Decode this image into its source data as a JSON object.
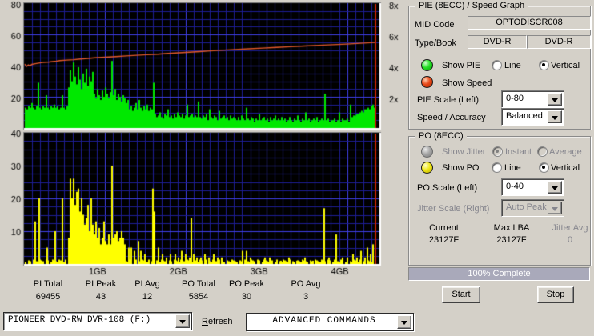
{
  "chart": {
    "grid": {
      "bg": "#000000",
      "minor": "#1e1e96",
      "major": "#4040e8"
    },
    "marker_color": "#cc2200",
    "x_labels": [
      "1GB",
      "2GB",
      "3GB",
      "4GB"
    ],
    "pie_plot": {
      "y_ticks": [
        "80",
        "60",
        "40",
        "20"
      ],
      "speed_ticks": [
        "8x",
        "6x",
        "4x",
        "2x"
      ],
      "bar_color": "#00e800",
      "speed_color": "#e55a2b",
      "bar_values": [
        13,
        12,
        14,
        13,
        16,
        13,
        12,
        14,
        29,
        13,
        12,
        14,
        13,
        21,
        13,
        12,
        14,
        13,
        15,
        13,
        14,
        12,
        13,
        21,
        13,
        12,
        14,
        26,
        37,
        30,
        42,
        33,
        28,
        39,
        31,
        25,
        35,
        29,
        38,
        27,
        33,
        30,
        36,
        22,
        19,
        25,
        21,
        18,
        24,
        20,
        26,
        22,
        19,
        23,
        43,
        21,
        25,
        18,
        22,
        20,
        17,
        21,
        19,
        16,
        18,
        12,
        14,
        11,
        13,
        16,
        12,
        18,
        13,
        11,
        14,
        12,
        15,
        11,
        13,
        12,
        29,
        9,
        7,
        8,
        10,
        7,
        6,
        9,
        8,
        12,
        7,
        8,
        6,
        9,
        7,
        10,
        8,
        7,
        9,
        6,
        8,
        15,
        7,
        8,
        9,
        7,
        8,
        7,
        17,
        7,
        6,
        8,
        7,
        9,
        5,
        12,
        7,
        6,
        8,
        7,
        5,
        11,
        6,
        7,
        8,
        6,
        7,
        5,
        8,
        6,
        7,
        6,
        5,
        7,
        5,
        8,
        6,
        5,
        13,
        6,
        5,
        7,
        6,
        4,
        6,
        5,
        9,
        5,
        6,
        7,
        5,
        6,
        4,
        7,
        5,
        6,
        8,
        5,
        6,
        5,
        7,
        5,
        6,
        4,
        5,
        7,
        5,
        4,
        6,
        5,
        8,
        5,
        4,
        6,
        5,
        10,
        5,
        6,
        4,
        5,
        6,
        5,
        7,
        4,
        5,
        6,
        5,
        22,
        5,
        6,
        4,
        5,
        5,
        6,
        4,
        5,
        10,
        4,
        6,
        5,
        5,
        6,
        4,
        15,
        7,
        8,
        8,
        9,
        9,
        10,
        11,
        10,
        12,
        12,
        13,
        12,
        14,
        15,
        13
      ],
      "speed_line": [
        [
          0,
          41
        ],
        [
          0.005,
          39.5
        ],
        [
          0.01,
          40.5
        ],
        [
          0.015,
          39.8
        ],
        [
          0.02,
          40.8
        ],
        [
          0.03,
          41.2
        ],
        [
          0.05,
          42
        ],
        [
          0.07,
          42.3
        ],
        [
          0.09,
          42.8
        ],
        [
          0.1,
          43.2
        ],
        [
          0.12,
          43.5
        ],
        [
          0.14,
          43.8
        ],
        [
          0.16,
          44.2
        ],
        [
          0.18,
          44.6
        ],
        [
          0.2,
          45
        ],
        [
          0.23,
          45.4
        ],
        [
          0.26,
          45.8
        ],
        [
          0.29,
          46.2
        ],
        [
          0.32,
          46.6
        ],
        [
          0.35,
          47
        ],
        [
          0.38,
          47.3
        ],
        [
          0.41,
          47.8
        ],
        [
          0.44,
          48.2
        ],
        [
          0.47,
          48.6
        ],
        [
          0.5,
          49
        ],
        [
          0.53,
          49.4
        ],
        [
          0.56,
          49.8
        ],
        [
          0.6,
          50.3
        ],
        [
          0.64,
          50.8
        ],
        [
          0.68,
          51.2
        ],
        [
          0.72,
          51.7
        ],
        [
          0.76,
          52.1
        ],
        [
          0.8,
          52.6
        ],
        [
          0.84,
          53
        ],
        [
          0.88,
          53.4
        ],
        [
          0.92,
          53.8
        ],
        [
          0.96,
          54.3
        ],
        [
          1,
          54.8
        ]
      ]
    },
    "po_plot": {
      "y_ticks": [
        "40",
        "30",
        "20",
        "10"
      ],
      "spike_color": "#ffff00",
      "spikes": [
        [
          43,
          13
        ],
        [
          48,
          20
        ],
        [
          58,
          5
        ],
        [
          68,
          10
        ],
        [
          77,
          20
        ],
        [
          85,
          8
        ],
        [
          87,
          26
        ],
        [
          89,
          20
        ],
        [
          91,
          26
        ],
        [
          93,
          18
        ],
        [
          95,
          22
        ],
        [
          97,
          23
        ],
        [
          99,
          16
        ],
        [
          101,
          20
        ],
        [
          103,
          15
        ],
        [
          105,
          12
        ],
        [
          107,
          14
        ],
        [
          109,
          18
        ],
        [
          111,
          10
        ],
        [
          113,
          20
        ],
        [
          115,
          12
        ],
        [
          117,
          9
        ],
        [
          119,
          13
        ],
        [
          121,
          8
        ],
        [
          123,
          11
        ],
        [
          125,
          6
        ],
        [
          127,
          8
        ],
        [
          129,
          13
        ],
        [
          131,
          7
        ],
        [
          133,
          6
        ],
        [
          135,
          9
        ],
        [
          137,
          6
        ],
        [
          139,
          30
        ],
        [
          141,
          8
        ],
        [
          143,
          9
        ],
        [
          145,
          10
        ],
        [
          147,
          7
        ],
        [
          149,
          8
        ],
        [
          151,
          10
        ],
        [
          153,
          8
        ],
        [
          155,
          6
        ],
        [
          160,
          5
        ],
        [
          163,
          5
        ],
        [
          167,
          4
        ],
        [
          172,
          7
        ],
        [
          175,
          4
        ],
        [
          180,
          3
        ],
        [
          190,
          23
        ],
        [
          192,
          16
        ],
        [
          197,
          5
        ],
        [
          202,
          3
        ],
        [
          207,
          2
        ],
        [
          212,
          3
        ],
        [
          218,
          3
        ],
        [
          222,
          2
        ],
        [
          226,
          4
        ],
        [
          231,
          3
        ],
        [
          236,
          2
        ],
        [
          238,
          14
        ],
        [
          241,
          3
        ],
        [
          245,
          2
        ],
        [
          250,
          2
        ],
        [
          255,
          3
        ],
        [
          260,
          2
        ],
        [
          266,
          3
        ],
        [
          271,
          2
        ],
        [
          276,
          2
        ],
        [
          302,
          4
        ],
        [
          307,
          4
        ],
        [
          312,
          2
        ],
        [
          330,
          2
        ],
        [
          336,
          2
        ],
        [
          350,
          1
        ],
        [
          360,
          2
        ],
        [
          370,
          1
        ],
        [
          380,
          2
        ],
        [
          390,
          1
        ],
        [
          404,
          17
        ],
        [
          410,
          2
        ],
        [
          419,
          9
        ],
        [
          427,
          2
        ],
        [
          433,
          2
        ],
        [
          440,
          3
        ],
        [
          445,
          2
        ],
        [
          450,
          4
        ],
        [
          455,
          2
        ],
        [
          458,
          5
        ],
        [
          462,
          3
        ],
        [
          465,
          6
        ]
      ]
    }
  },
  "stats": [
    {
      "label": "PI Total",
      "value": "69455"
    },
    {
      "label": "PI Peak",
      "value": "43"
    },
    {
      "label": "PI Avg",
      "value": "12"
    },
    {
      "label": "PO Total",
      "value": "5854"
    },
    {
      "label": "PO Peak",
      "value": "30"
    },
    {
      "label": "PO Avg",
      "value": "3"
    }
  ],
  "pie_group": {
    "title": "PIE (8ECC) / Speed Graph",
    "mid_label": "MID Code",
    "mid_value": "OPTODISCR008",
    "type_label": "Type/Book",
    "type_value_1": "DVD-R",
    "type_value_2": "DVD-R",
    "show_pie": "Show PIE",
    "show_speed": "Show Speed",
    "line_label": "Line",
    "vertical_label": "Vertical",
    "scale_label": "PIE Scale (Left)",
    "scale_value": "0-80",
    "speed_acc_label": "Speed / Accuracy",
    "speed_acc_value": "Balanced",
    "led_colors": {
      "pie": "#27e027",
      "speed": "#e84818"
    }
  },
  "po_group": {
    "title": "PO (8ECC)",
    "show_jitter": "Show Jitter",
    "instant_label": "Instant",
    "average_label": "Average",
    "show_po": "Show PO",
    "line_label": "Line",
    "vertical_label": "Vertical",
    "scale_label": "PO Scale (Left)",
    "scale_value": "0-40",
    "jitter_scale_label": "Jitter Scale (Right)",
    "jitter_scale_value": "Auto Peak",
    "current_label": "Current",
    "current_value": "23127F",
    "maxlba_label": "Max LBA",
    "maxlba_value": "23127F",
    "jitteravg_label": "Jitter Avg",
    "jitteravg_value": "0",
    "led_colors": {
      "po": "#f0e818",
      "jitter": "#a8a8a8"
    }
  },
  "progress": {
    "text": "100% Complete",
    "fill_color": "#a9a9ba"
  },
  "buttons": {
    "start": {
      "label": "Start",
      "key": "S"
    },
    "stop": {
      "label": "Stop",
      "key": "t"
    }
  },
  "bottom": {
    "drive": "PIONEER DVD-RW  DVR-108  (F:)",
    "refresh": {
      "label": "Refresh",
      "key": "R"
    },
    "advanced": "ADVANCED COMMANDS"
  }
}
